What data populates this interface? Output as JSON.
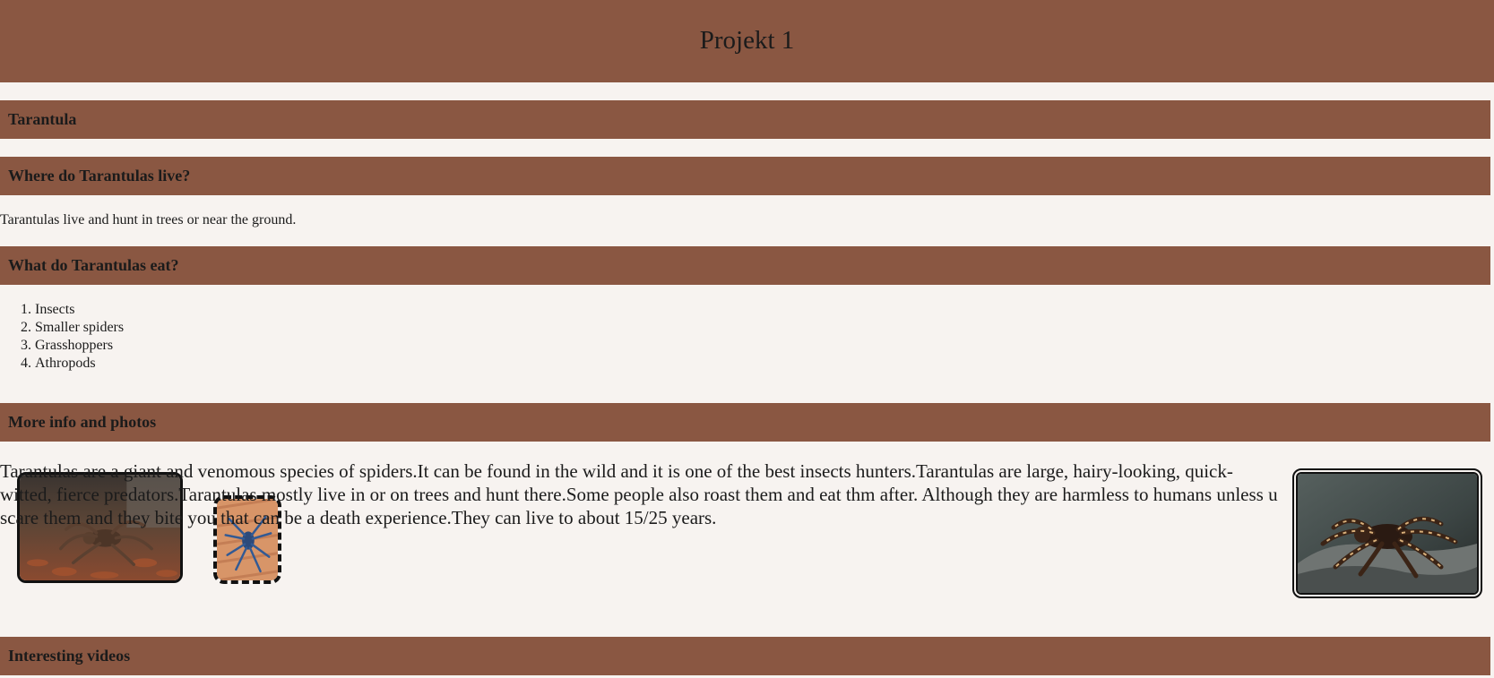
{
  "page": {
    "title": "Projekt 1"
  },
  "sections": {
    "tarantula": "Tarantula",
    "where": "Where do Tarantulas live?",
    "where_text": "Tarantulas live and hunt in trees or near the ground.",
    "eat": "What do Tarantulas eat?",
    "eat_items": [
      "Insects",
      "Smaller spiders",
      "Grasshoppers",
      "Athropods"
    ],
    "more": "More info and photos",
    "more_text": "Tarantulas are a giant and venomous species of spiders.It can be found in the wild and it is one of the best insects hunters.Tarantulas are large, hairy-looking, quick-witted, fierce predators.Tarantulas mostly live in or on trees and hunt there.Some people also roast them and eat thm after. Although they are harmless to humans unless u scare them and they bite you that can be a death experience.They can live to about 15/25 years.",
    "videos": "Interesting videos"
  },
  "images": {
    "left_1": "tarantula-on-leaves-photo",
    "left_2": "blue-tarantula-on-wood-photo",
    "right": "tarantula-on-rock-photo"
  },
  "colors": {
    "bar": "#8a5742",
    "background": "#f7f3f0",
    "text": "#1b1b1b"
  }
}
